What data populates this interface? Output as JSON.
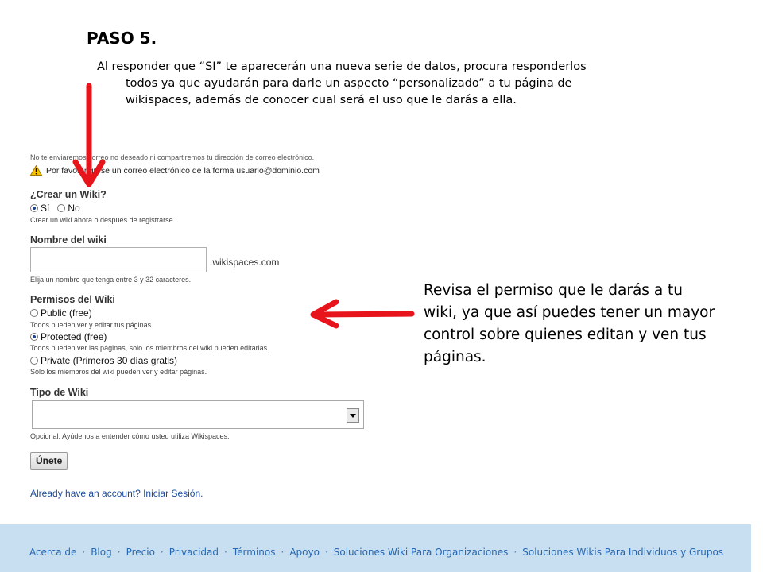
{
  "slide": {
    "title": "PASO 5.",
    "intro_line1": "Al responder que “SI” te aparecerán una nueva serie de datos, procura responderlos",
    "intro_line2": "todos ya que ayudarán para darle un aspecto “personalizado” a tu página de",
    "intro_line3": "wikispaces, además de conocer cual será el uso que le darás a ella.",
    "note": "Revisa el permiso que le darás a tu wiki, ya que así puedes tener un mayor control sobre quienes editan y ven tus páginas."
  },
  "form": {
    "spam_notice": "No te enviaremos correo no deseado ni compartiremos tu dirección de correo electrónico.",
    "warning": "Por favor ingrese un correo electrónico de la forma usuario@dominio.com",
    "create_wiki": {
      "label": "¿Crear un Wiki?",
      "option_yes": "Sí",
      "option_no": "No",
      "help": "Crear un wiki ahora o después de registrarse."
    },
    "wiki_name": {
      "label": "Nombre del wiki",
      "value": "",
      "suffix": ".wikispaces.com",
      "help": "Elija un nombre que tenga entre 3 y 32 caracteres."
    },
    "permissions": {
      "label": "Permisos del Wiki",
      "public": "Public (free)",
      "public_help": "Todos pueden ver y editar tus páginas.",
      "protected": "Protected (free)",
      "protected_help": "Todos pueden ver las páginas, solo los miembros del wiki pueden editarlas.",
      "private": "Private (Primeros 30 días gratis)",
      "private_help": "Sólo los miembros del wiki pueden ver y editar páginas."
    },
    "wiki_type": {
      "label": "Tipo de Wiki",
      "selected": "",
      "help": "Opcional: Ayúdenos a entender cómo usted utiliza Wikispaces."
    },
    "submit_label": "Únete",
    "account_link": "Already have an account? Iniciar Sesión."
  },
  "footer": {
    "links": [
      "Acerca de",
      "Blog",
      "Precio",
      "Privacidad",
      "Términos",
      "Apoyo",
      "Soluciones Wiki Para Organizaciones",
      "Soluciones Wikis Para Individuos y Grupos"
    ]
  },
  "colors": {
    "arrow": "#e8141b",
    "footer_bg": "#c7dff0",
    "link": "#2767b0"
  }
}
